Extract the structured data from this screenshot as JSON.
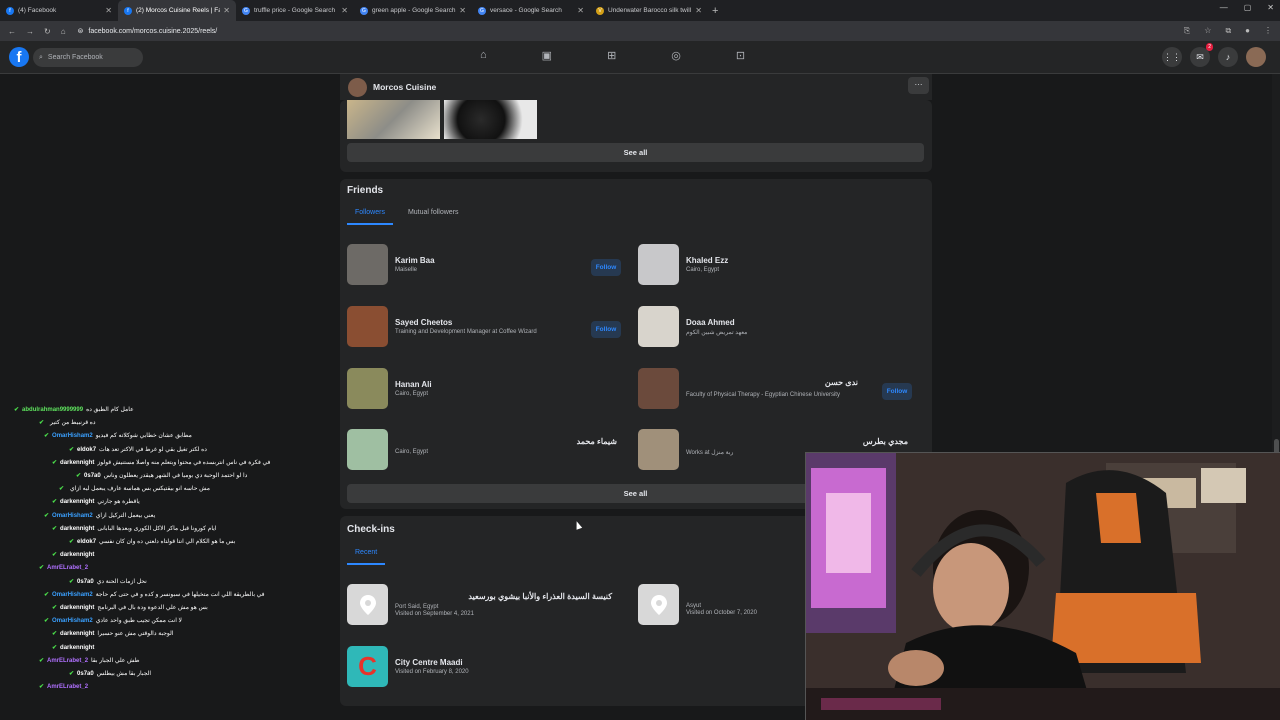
{
  "browser": {
    "tabs": [
      {
        "title": "(4) Facebook",
        "active": false,
        "favicon": "facebook-icon",
        "color": "#1877f2"
      },
      {
        "title": "(2) Morcos Cuisine Reels | Faceb",
        "active": true,
        "favicon": "facebook-icon",
        "color": "#1877f2"
      },
      {
        "title": "truffle price - Google Search",
        "active": false,
        "favicon": "google-icon",
        "color": "#4285f4"
      },
      {
        "title": "green apple - Google Search",
        "active": false,
        "favicon": "google-icon",
        "color": "#4285f4"
      },
      {
        "title": "versace - Google Search",
        "active": false,
        "favicon": "google-icon",
        "color": "#4285f4"
      },
      {
        "title": "Underwater Barocco silk twill sh",
        "active": false,
        "favicon": "versace-icon",
        "color": "#d4a017"
      }
    ],
    "new_tab": "+",
    "url": "facebook.com/morcos.cuisine.2025/reels/"
  },
  "facebook": {
    "search_placeholder": "Search Facebook",
    "messenger_badge": "2"
  },
  "page": {
    "name": "Morcos Cuisine",
    "more": "···"
  },
  "photos_see_all": "See all",
  "friends": {
    "title": "Friends",
    "tabs": [
      "Followers",
      "Mutual followers"
    ],
    "people": [
      {
        "name": "Karim Baa",
        "sub": "Maiselle",
        "follow": "Follow",
        "thumb": "#6d6a66"
      },
      {
        "name": "Khaled Ezz",
        "sub": "Cairo, Egypt",
        "follow": "",
        "thumb": "#c8c8ca"
      },
      {
        "name": "Sayed Cheetos",
        "sub": "Training and Development Manager at Coffee Wizard",
        "follow": "Follow",
        "thumb": "#8a4e32"
      },
      {
        "name": "Doaa Ahmed",
        "sub": "معهد تمريض شبين الكوم",
        "follow": "",
        "thumb": "#d8d4cc"
      },
      {
        "name": "Hanan Ali",
        "sub": "Cairo, Egypt",
        "follow": "",
        "thumb": "#8a8a5c"
      },
      {
        "name": "ندى حسن",
        "sub": "Faculty of Physical Therapy - Egyptian Chinese University",
        "follow": "Follow",
        "thumb": "#6b4a3c"
      },
      {
        "name": "شيماء محمد",
        "sub": "Cairo, Egypt",
        "follow": "",
        "thumb": "#9fbfa2"
      },
      {
        "name": "مجدي بطرس",
        "sub": "Works at ربة منزل",
        "follow": "",
        "thumb": "#a0907a"
      }
    ],
    "see_all": "See all"
  },
  "checkins": {
    "title": "Check-ins",
    "tab": "Recent",
    "places": [
      {
        "name": "كنيسة السيدة العذراء والأنبا بيشوي بورسعيد",
        "loc": "Port Said, Egypt",
        "date": "Visited on September 4, 2021",
        "icon": "map-pin-icon",
        "bg": "#d8d8d8"
      },
      {
        "name": "",
        "loc": "Asyut",
        "date": "Visited on October 7, 2020",
        "icon": "map-pin-icon",
        "bg": "#d8d8d8"
      },
      {
        "name": "City Centre Maadi",
        "loc": "",
        "date": "Visited on February 8, 2020",
        "icon": "city-centre-logo-icon",
        "bg": "#2fb8b8"
      }
    ]
  },
  "chat": [
    {
      "user": "abdulrahman9999999",
      "msg": "عامل كام الطبق ده",
      "color": "#5ee35e",
      "indent": 0
    },
    {
      "user": "",
      "msg": "ده قرنبيط من كتير",
      "color": "#ff3b3b",
      "indent": 25
    },
    {
      "user": "OmarHisham2",
      "msg": "مطابق عشان خطابي شوكلاته كم فيديو",
      "color": "#3aa0ff",
      "indent": 30
    },
    {
      "user": "eldok7",
      "msg": "ده لكتر تغيل بقي لو غرط في الاكتر تعد هات",
      "color": "#ffffff",
      "indent": 55
    },
    {
      "user": "darkennight",
      "msg": "في فكرة في ناس انتربسده في محتوا وبتعلم منه واصلا مستنيش قولوز",
      "color": "#ffffff",
      "indent": 38
    },
    {
      "user": "0s7a0",
      "msg": "دا لو احتمد الوحبة دي بوميا في الشهر هيقدر يعطلون وناس",
      "color": "#ffffff",
      "indent": 62
    },
    {
      "user": "",
      "msg": "مش حاسه انو بيقتيكس بس هماسة عارف يبعمل ليه ازاي",
      "color": "#ff3b3b",
      "indent": 45
    },
    {
      "user": "darkennight",
      "msg": "ياقطرة هو جارتي",
      "color": "#ffffff",
      "indent": 38
    },
    {
      "user": "OmarHisham2",
      "msg": "يعني بيعمل التركيل ازاي",
      "color": "#3aa0ff",
      "indent": 30
    },
    {
      "user": "darkennight",
      "msg": "ايام كورونا قبل ماكر الاكل الكورى وبعدها البابانى",
      "color": "#ffffff",
      "indent": 38
    },
    {
      "user": "eldok7",
      "msg": "بس ما هو الكلام الي انتا قولتاه دلعتي ده وان كان نفسي",
      "color": "#ffffff",
      "indent": 55
    },
    {
      "user": "darkennight",
      "msg": "",
      "color": "#ffffff",
      "indent": 38
    },
    {
      "user": "AmrELrabet_2",
      "msg": "",
      "color": "#b070ff",
      "indent": 25
    },
    {
      "user": "0s7a0",
      "msg": "نحل ازمات الحنة دي",
      "color": "#ffffff",
      "indent": 55
    },
    {
      "user": "OmarHisham2",
      "msg": "في بالطريقة اللي انت متخيلها في سبونسر و كده و في حتى كم حاجة",
      "color": "#3aa0ff",
      "indent": 30
    },
    {
      "user": "darkennight",
      "msg": "بس هو مش علي الدعوة ودة بال في البرنامج",
      "color": "#ffffff",
      "indent": 38
    },
    {
      "user": "OmarHisham2",
      "msg": "لا انت ممكن تجيب طبق واحد عادي",
      "color": "#3aa0ff",
      "indent": 30
    },
    {
      "user": "darkennight",
      "msg": "الوجبة دالوقتي مش عنو حسيرا",
      "color": "#ffffff",
      "indent": 38
    },
    {
      "user": "darkennight",
      "msg": "",
      "color": "#ffffff",
      "indent": 38
    },
    {
      "user": "AmrELrabet_2",
      "msg": "طش علي الجبار بقا",
      "color": "#b070ff",
      "indent": 25
    },
    {
      "user": "0s7a0",
      "msg": "الجبار بقا مش بيطلس",
      "color": "#ffffff",
      "indent": 55
    },
    {
      "user": "AmrELrabet_2",
      "msg": "",
      "color": "#b070ff",
      "indent": 25
    }
  ]
}
